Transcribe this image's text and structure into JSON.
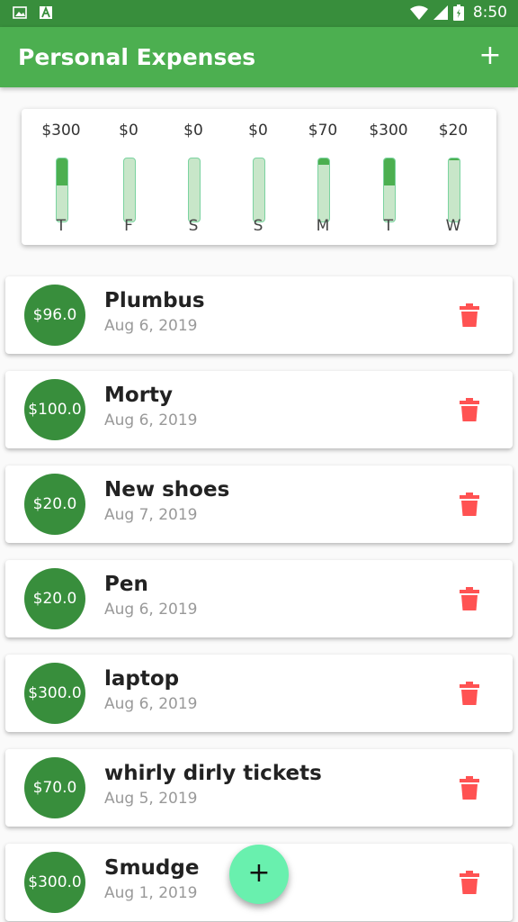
{
  "status_bar": {
    "time": "8:50"
  },
  "app_bar": {
    "title": "Personal Expenses",
    "add_icon": "plus-icon"
  },
  "chart": {
    "days": [
      {
        "amount": "$300",
        "day": "T",
        "fill": 0.43
      },
      {
        "amount": "$0",
        "day": "F",
        "fill": 0
      },
      {
        "amount": "$0",
        "day": "S",
        "fill": 0
      },
      {
        "amount": "$0",
        "day": "S",
        "fill": 0
      },
      {
        "amount": "$70",
        "day": "M",
        "fill": 0.1
      },
      {
        "amount": "$300",
        "day": "T",
        "fill": 0.43
      },
      {
        "amount": "$20",
        "day": "W",
        "fill": 0.03
      }
    ]
  },
  "transactions": [
    {
      "amount": "$96.0",
      "title": "Plumbus",
      "date": "Aug 6, 2019"
    },
    {
      "amount": "$100.0",
      "title": "Morty",
      "date": "Aug 6, 2019"
    },
    {
      "amount": "$20.0",
      "title": "New shoes",
      "date": "Aug 7, 2019"
    },
    {
      "amount": "$20.0",
      "title": "Pen",
      "date": "Aug 6, 2019"
    },
    {
      "amount": "$300.0",
      "title": "laptop",
      "date": "Aug 6, 2019"
    },
    {
      "amount": "$70.0",
      "title": "whirly dirly tickets",
      "date": "Aug 5, 2019"
    },
    {
      "amount": "$300.0",
      "title": "Smudge",
      "date": "Aug 1, 2019"
    }
  ],
  "fab": {
    "label": "+"
  },
  "colors": {
    "primary": "#4caf50",
    "primary_dark": "#388e3c",
    "accent": "#69f0ae",
    "delete": "#ff5252"
  }
}
